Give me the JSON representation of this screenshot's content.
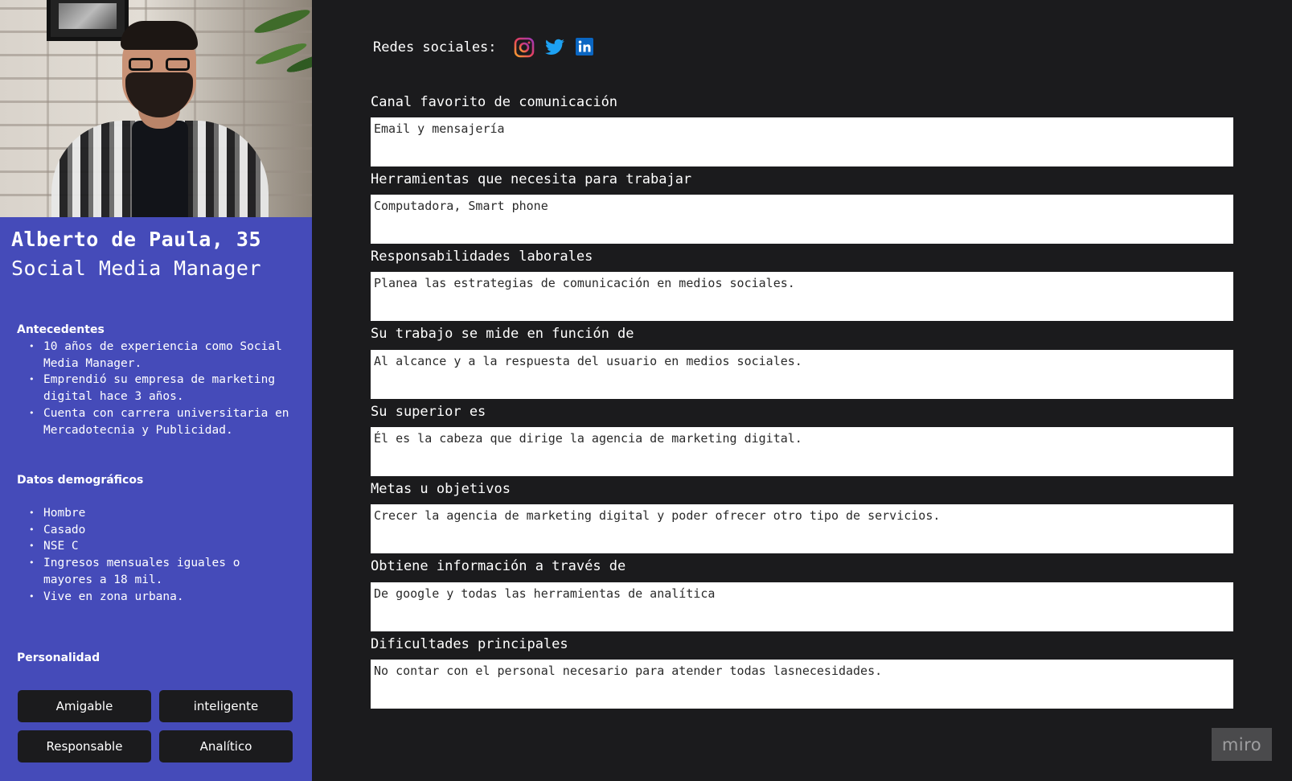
{
  "persona": {
    "name": "Alberto de Paula, 35",
    "role": "Social Media Manager"
  },
  "background": {
    "title": "Antecedentes",
    "items": [
      "10 años de experiencia como Social Media Manager.",
      "Emprendió su empresa de marketing digital hace 3 años.",
      "Cuenta con carrera universitaria en Mercadotecnia y Publicidad."
    ]
  },
  "demographics": {
    "title": "Datos demográficos",
    "items": [
      "Hombre",
      "Casado",
      "NSE C",
      "Ingresos mensuales iguales o mayores a 18 mil.",
      "Vive en zona urbana."
    ]
  },
  "personality": {
    "title": "Personalidad",
    "tags": [
      "Amigable",
      "inteligente",
      "Responsable",
      "Analítico"
    ]
  },
  "social": {
    "label": "Redes sociales:",
    "icons": [
      "instagram-icon",
      "twitter-icon",
      "linkedin-icon"
    ],
    "colors": {
      "instagram": "#e4405f",
      "twitter": "#1da1f2",
      "linkedin": "#0a66c2"
    }
  },
  "fields": [
    {
      "label": "Canal favorito de comunicación",
      "value": "Email y mensajería"
    },
    {
      "label": "Herramientas que necesita para trabajar",
      "value": "Computadora, Smart phone"
    },
    {
      "label": "Responsabilidades laborales",
      "value": "Planea las estrategias de comunicación en medios sociales."
    },
    {
      "label": "Su trabajo se mide en función de",
      "value": "Al alcance y a la respuesta del usuario en medios sociales."
    },
    {
      "label": "Su superior es",
      "value": "Él es la cabeza que dirige la agencia de marketing digital."
    },
    {
      "label": "Metas u objetivos",
      "value": "Crecer la agencia de marketing digital y poder ofrecer otro tipo de servicios."
    },
    {
      "label": "Obtiene información a través de",
      "value": "De google y todas las herramientas de analítica"
    },
    {
      "label": "Dificultades principales",
      "value": "No contar con el personal necesario para atender todas lasnecesidades."
    }
  ],
  "watermark": "miro",
  "colors": {
    "sidebar": "#454bb9",
    "background": "#1b1b1d",
    "field": "#ffffff"
  }
}
